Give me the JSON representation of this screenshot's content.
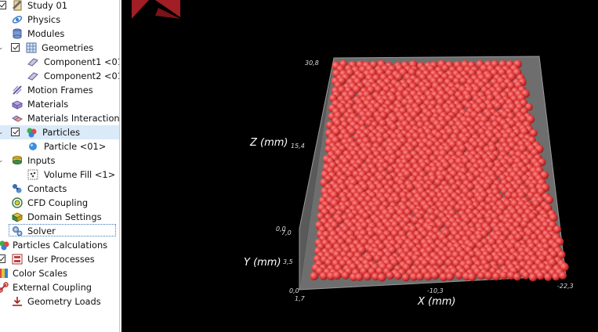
{
  "tree": {
    "items": [
      {
        "label": "Study 01",
        "icon": "study-icon"
      },
      {
        "label": "Physics",
        "icon": "physics-icon"
      },
      {
        "label": "Modules",
        "icon": "modules-icon"
      },
      {
        "label": "Geometries",
        "icon": "geometries-icon"
      },
      {
        "label": "Component1 <01",
        "icon": "component-icon"
      },
      {
        "label": "Component2 <01",
        "icon": "component-icon"
      },
      {
        "label": "Motion Frames",
        "icon": "motion-frames-icon"
      },
      {
        "label": "Materials",
        "icon": "materials-icon"
      },
      {
        "label": "Materials Interactions",
        "icon": "materials-interactions-icon"
      },
      {
        "label": "Particles",
        "icon": "particles-icon"
      },
      {
        "label": "Particle <01>",
        "icon": "particle-icon"
      },
      {
        "label": "Inputs",
        "icon": "inputs-icon"
      },
      {
        "label": "Volume Fill <1>",
        "icon": "volume-fill-icon"
      },
      {
        "label": "Contacts",
        "icon": "contacts-icon"
      },
      {
        "label": "CFD Coupling",
        "icon": "cfd-coupling-icon"
      },
      {
        "label": "Domain Settings",
        "icon": "domain-settings-icon"
      },
      {
        "label": "Solver",
        "icon": "solver-icon"
      },
      {
        "label": "Particles Calculations",
        "icon": "particles-calculations-icon"
      },
      {
        "label": "User Processes",
        "icon": "user-processes-icon"
      },
      {
        "label": "Color Scales",
        "icon": "color-scales-icon"
      },
      {
        "label": "External Coupling",
        "icon": "external-coupling-icon"
      },
      {
        "label": "Geometry Loads",
        "icon": "geometry-loads-icon"
      }
    ]
  },
  "viewport": {
    "axes": {
      "z": {
        "title": "Z (mm)",
        "ticks": [
          "30,8",
          "15,4",
          "0,0"
        ]
      },
      "y": {
        "title": "Y (mm)",
        "ticks": [
          "7,0",
          "3,5",
          "0,0"
        ]
      },
      "x": {
        "title": "X (mm)",
        "ticks": [
          "1,7",
          "-10,3",
          "-22,3"
        ]
      }
    },
    "colors": {
      "particles": "#e03c3c",
      "background": "#000000",
      "logo": "#a01e24"
    }
  }
}
